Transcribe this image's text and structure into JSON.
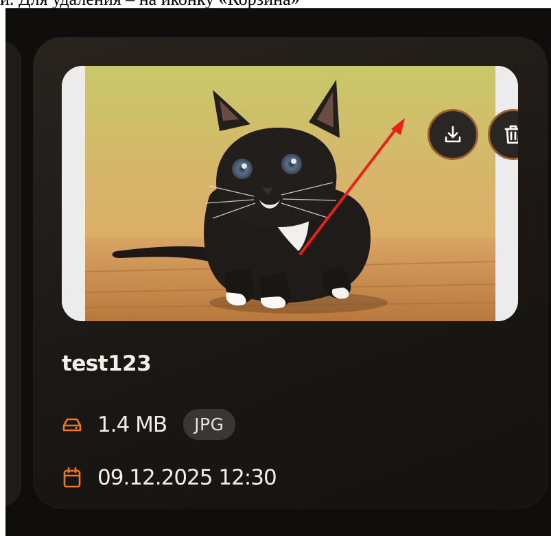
{
  "caption": {
    "text": "и. Для удаления – на иконку «Корзина»"
  },
  "file_card": {
    "name": "test123",
    "size": "1.4 MB",
    "type": "JPG",
    "date": "09.12.2025 12:30",
    "actions": {
      "download_icon": "download-icon",
      "delete_icon": "trash-icon"
    },
    "meta_icons": {
      "size_icon": "hard-drive-icon",
      "date_icon": "calendar-icon"
    },
    "preview_subject": "black-and-white kitten on wooden floor"
  },
  "annotation": {
    "arrow_color": "#e8201a"
  },
  "colors": {
    "accent": "#f07a20",
    "card_bg": "#1e1a17",
    "button_ring": "#9a5f33",
    "badge_bg": "#3a3633",
    "text": "#f4f0ea"
  }
}
